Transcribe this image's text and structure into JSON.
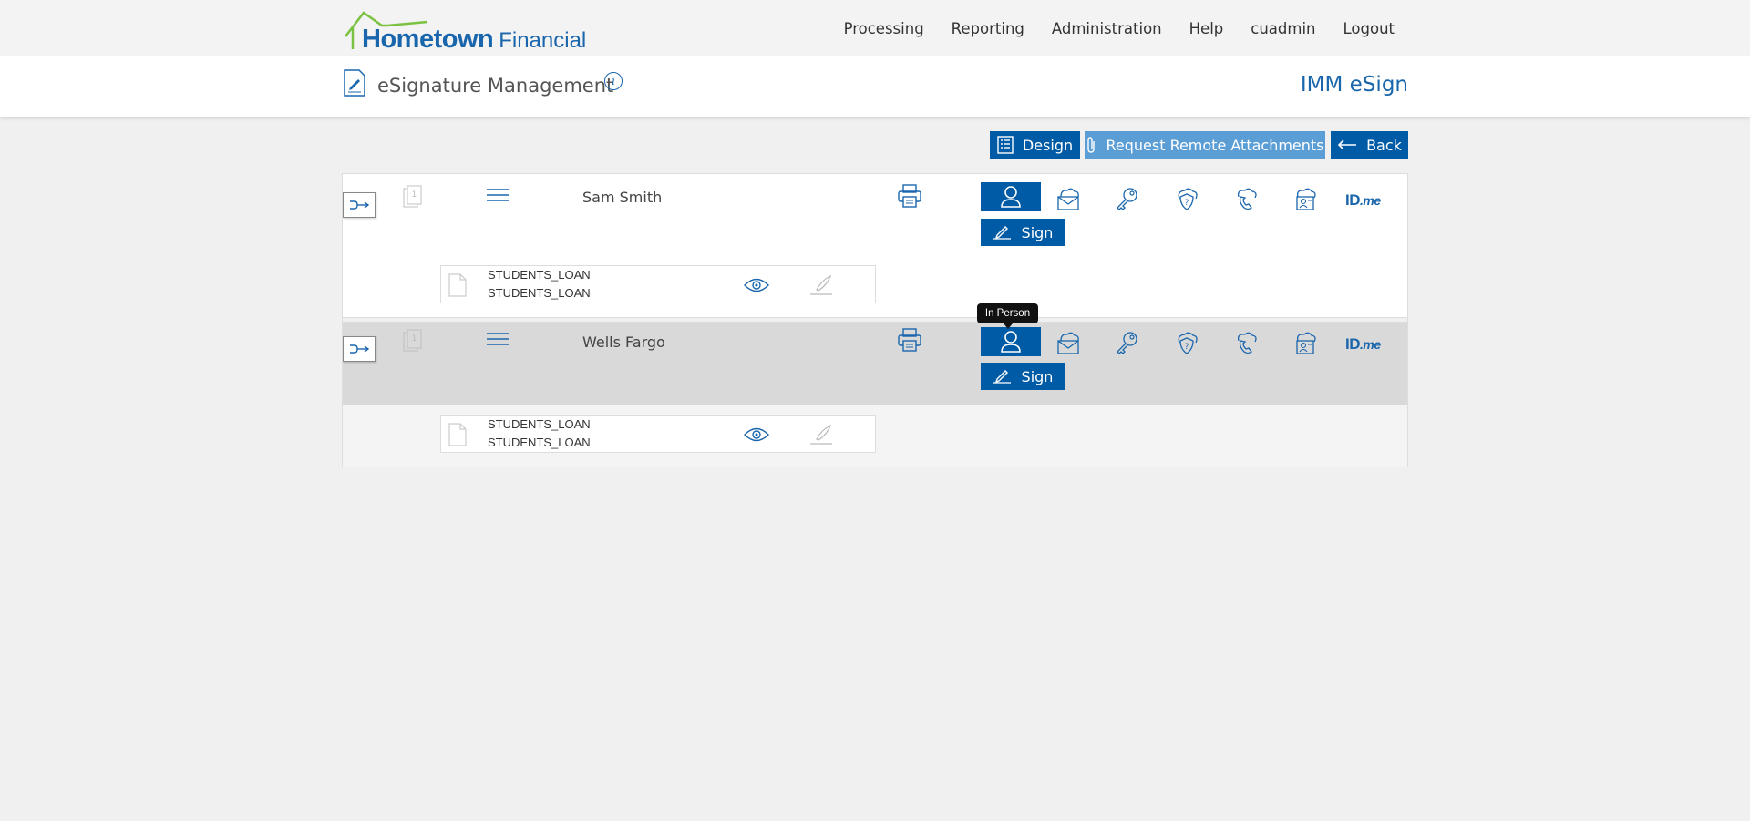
{
  "brand": {
    "name": "Hometown",
    "sub": "Financial"
  },
  "nav": [
    "Processing",
    "Reporting",
    "Administration",
    "Help",
    "cuadmin",
    "Logout"
  ],
  "header": {
    "title": "eSignature Management",
    "info": "i",
    "app_name": "IMM eSign"
  },
  "actions": {
    "design": "Design",
    "attachments": "Request Remote Attachments",
    "back": "Back"
  },
  "signers": [
    {
      "name": "Sam Smith",
      "sign_label": "Sign",
      "documents": [
        {
          "line1": "STUDENTS_LOAN",
          "line2": "STUDENTS_LOAN"
        }
      ]
    },
    {
      "name": "Wells Fargo",
      "sign_label": "Sign",
      "documents": [
        {
          "line1": "STUDENTS_LOAN",
          "line2": "STUDENTS_LOAN"
        }
      ]
    }
  ],
  "methods": [
    "in-person-icon",
    "email-icon",
    "key-icon",
    "security-question-icon",
    "phone-icon",
    "id-check-icon",
    "idme-logo"
  ],
  "idme": {
    "id": "ID",
    "me": ".me"
  },
  "tooltip": "In Person",
  "colors": {
    "primary": "#005ba6",
    "secondary": "#5b9ed6",
    "brand_green": "#7cc242"
  }
}
